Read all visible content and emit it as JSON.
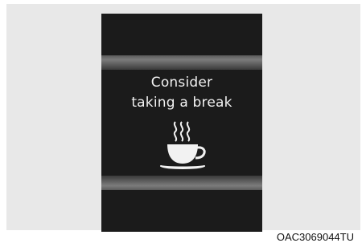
{
  "display": {
    "message_line1": "Consider",
    "message_line2": "taking a break",
    "icon": "coffee-cup-icon",
    "background_color": "#1b1b1b",
    "text_color": "#f2f2f2"
  },
  "figure_code": "OAC3069044TU"
}
